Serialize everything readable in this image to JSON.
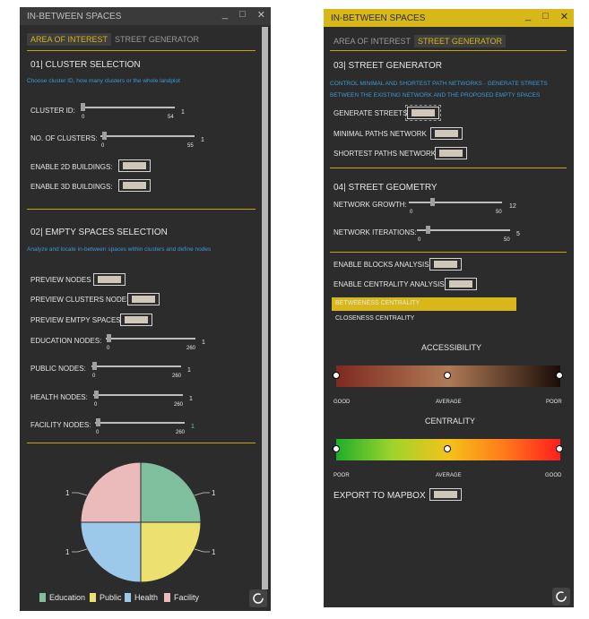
{
  "left": {
    "title": "IN-BETWEEN SPACES",
    "window_controls": [
      "_",
      "□",
      "✕"
    ],
    "tabs": [
      {
        "label": "AREA OF INTEREST",
        "active": true
      },
      {
        "label": "STREET GENERATOR",
        "active": false
      }
    ],
    "cluster": {
      "title": "01| CLUSTER SELECTION",
      "description": "Choose cluster ID, how many clusters or the whole landplot",
      "cluster_id": {
        "label": "CLUSTER ID:",
        "min": "0",
        "max": "54",
        "value": "1"
      },
      "no_clusters": {
        "label": "NO. OF CLUSTERS:",
        "min": "0",
        "max": "55",
        "value": "1"
      },
      "enable_2d": "ENABLE 2D BUILDINGS:",
      "enable_3d": "ENABLE 3D BUILDINGS:"
    },
    "empty": {
      "title": "02| EMPTY SPACES SELECTION",
      "description": "Analyze and locate in-between spaces within clusters and define nodes",
      "preview_nodes": "PREVIEW NODES",
      "preview_clusters": "PREVIEW CLUSTERS NODES",
      "preview_empty": "PREVIEW EMTPY SPACES",
      "education": {
        "label": "EDUCATION NODES:",
        "min": "0",
        "max": "260",
        "value": "1"
      },
      "public": {
        "label": "PUBLIC NODES:",
        "min": "0",
        "max": "260",
        "value": "1"
      },
      "health": {
        "label": "HEALTH NODES:",
        "min": "0",
        "max": "260",
        "value": "1"
      },
      "facility": {
        "label": "FACILITY NODES:",
        "min": "0",
        "max": "260",
        "value": "1"
      }
    },
    "pie": {
      "labels": [
        "1",
        "1",
        "1",
        "1"
      ],
      "legend": [
        {
          "name": "Education",
          "color": "#7fbf9e"
        },
        {
          "name": "Public",
          "color": "#ece06e"
        },
        {
          "name": "Health",
          "color": "#9cc8ea"
        },
        {
          "name": "Facility",
          "color": "#ebbaba"
        }
      ]
    }
  },
  "right": {
    "title": "IN-BETWEEN SPACES",
    "window_controls": [
      "_",
      "□",
      "✕"
    ],
    "tabs": [
      {
        "label": "AREA OF INTEREST",
        "active": false
      },
      {
        "label": "STREET GENERATOR",
        "active": true
      }
    ],
    "street": {
      "title": "03| STREET GENERATOR",
      "description_1": "CONTROL MINIMAL AND SHORTEST PATH NETWORKS - GENERATE STREETS",
      "description_2": "BETWEEN THE EXISTING NETWORK AND THE PROPOSED EMPTY SPACES",
      "generate": "GENERATE STREETS",
      "minimal": "MINIMAL PATHS NETWORK",
      "shortest": "SHORTEST PATHS NETWORK"
    },
    "geometry": {
      "title": "04| STREET GEOMETRY",
      "growth": {
        "label": "NETWORK GROWTH:",
        "min": "0",
        "max": "50",
        "value": "12"
      },
      "iterations": {
        "label": "NETWORK ITERATIONS:",
        "min": "0",
        "max": "50",
        "value": "5"
      }
    },
    "analysis": {
      "blocks": "ENABLE BLOCKS ANALYSIS:",
      "centrality": "ENABLE CENTRALITY ANALYSIS:",
      "options": [
        {
          "label": "BETWEENESS CENTRALITY",
          "selected": true
        },
        {
          "label": "CLOSENESS CENTRALITY",
          "selected": false
        }
      ]
    },
    "accessibility": {
      "title": "ACCESSIBILITY",
      "labels": [
        "GOOD",
        "AVERAGE",
        "POOR"
      ],
      "colors": [
        "#8a2f24",
        "#b07a55",
        "#1e0f08"
      ]
    },
    "centrality": {
      "title": "CENTRALITY",
      "labels": [
        "POOR",
        "AVERAGE",
        "GOOD"
      ],
      "colors": [
        "#2bb52b",
        "#f4c21a",
        "#ff1e1e"
      ]
    },
    "export": "EXPORT TO MAPBOX"
  },
  "colors": {
    "accent": "#c9a30a",
    "link": "#3a9ad6",
    "bg": "#2c2c2c"
  }
}
